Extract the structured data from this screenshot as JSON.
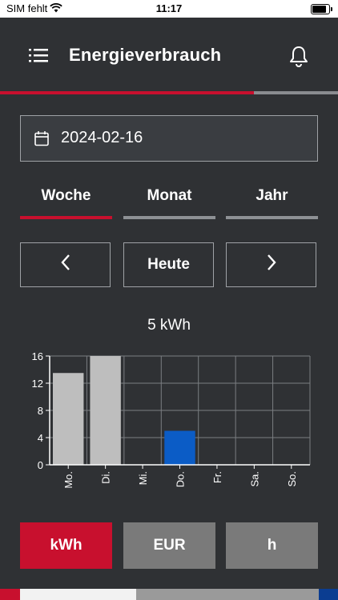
{
  "status_bar": {
    "carrier": "SIM fehlt",
    "time": "11:17"
  },
  "header": {
    "title": "Energieverbrauch",
    "menu_icon": "hamburger-menu-icon",
    "notification_icon": "bell-icon"
  },
  "progress": {
    "fraction": 0.75,
    "color": "#c8102e"
  },
  "date_field": {
    "value": "2024-02-16",
    "icon": "calendar-icon"
  },
  "tabs": [
    {
      "label": "Woche",
      "active": true
    },
    {
      "label": "Monat",
      "active": false
    },
    {
      "label": "Jahr",
      "active": false
    }
  ],
  "navigation": {
    "prev_icon": "chevron-left-icon",
    "today_label": "Heute",
    "next_icon": "chevron-right-icon"
  },
  "chart_data": {
    "type": "bar",
    "title": "5 kWh",
    "categories": [
      "Mo.",
      "Di.",
      "Mi.",
      "Do.",
      "Fr.",
      "Sa.",
      "So."
    ],
    "values": [
      13.5,
      16,
      0,
      5,
      0,
      0,
      0
    ],
    "highlight_index": 3,
    "ylim": [
      0,
      16
    ],
    "yticks": [
      0,
      4,
      8,
      12,
      16
    ],
    "grid": true,
    "colors": {
      "bar": "#bebebe",
      "highlight": "#0b5cc6",
      "grid": "#7b7e82"
    }
  },
  "units": [
    {
      "label": "kWh",
      "active": true
    },
    {
      "label": "EUR",
      "active": false
    },
    {
      "label": "h",
      "active": false
    }
  ],
  "colors": {
    "background": "#2f3134",
    "accent": "#c8102e",
    "inactive": "#7a7a7a"
  }
}
